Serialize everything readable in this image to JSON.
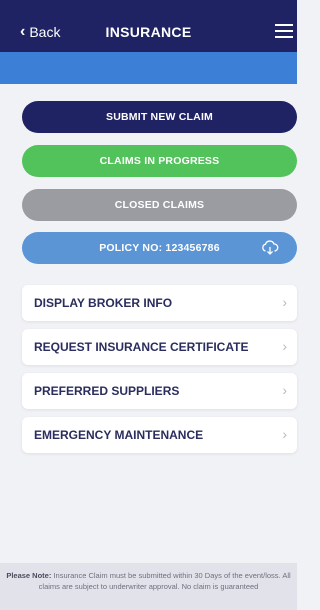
{
  "header": {
    "back_label": "Back",
    "back_icon": "chevron-left-icon",
    "title": "INSURANCE",
    "menu_icon": "hamburger-menu-icon"
  },
  "actions": {
    "submit_label": "SUBMIT NEW CLAIM",
    "progress_label": "CLAIMS IN PROGRESS",
    "closed_label": "CLOSED CLAIMS",
    "policy_label": "POLICY NO: 123456786",
    "policy_icon": "cloud-download-icon"
  },
  "menu_items": [
    {
      "label": "DISPLAY BROKER INFO"
    },
    {
      "label": "REQUEST INSURANCE CERTIFICATE"
    },
    {
      "label": "PREFERRED SUPPLIERS"
    },
    {
      "label": "EMERGENCY MAINTENANCE"
    }
  ],
  "note": {
    "prefix": "Please Note:",
    "text": "Insurance Claim must be submitted within 30 Days of the event/loss. All claims are subject to underwriter approval. No claim is guaranteed"
  },
  "colors": {
    "header_bg": "#1f2363",
    "band_blue": "#3b7fd7",
    "submit": "#1f2363",
    "in_progress": "#51c35a",
    "closed": "#9b9ca1",
    "policy": "#5b95d6"
  }
}
